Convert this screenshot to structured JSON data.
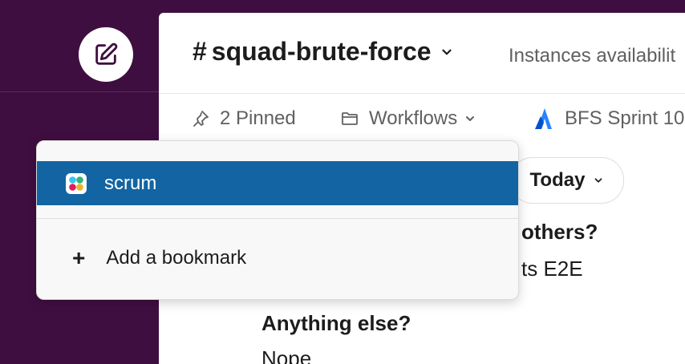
{
  "channel": {
    "name": "squad-brute-force",
    "hash": "#",
    "topic": "Instances availabilit"
  },
  "bookmarks_bar": {
    "pinned_label": "2 Pinned",
    "workflows_label": "Workflows",
    "sprint_label": "BFS Sprint 10"
  },
  "content": {
    "date_pill": "Today",
    "lines": [
      {
        "text": "others?",
        "bold": true
      },
      {
        "text": "ts E2E",
        "bold": false
      },
      {
        "text": "Anything else?",
        "bold": true
      },
      {
        "text": "Nope",
        "bold": false
      }
    ]
  },
  "dropdown": {
    "selected_item": "scrum",
    "add_label": "Add a bookmark",
    "add_symbol": "+"
  },
  "colors": {
    "sidebar": "#3f0e40",
    "selection": "#1264a3",
    "jira_blue": "#2684ff"
  }
}
